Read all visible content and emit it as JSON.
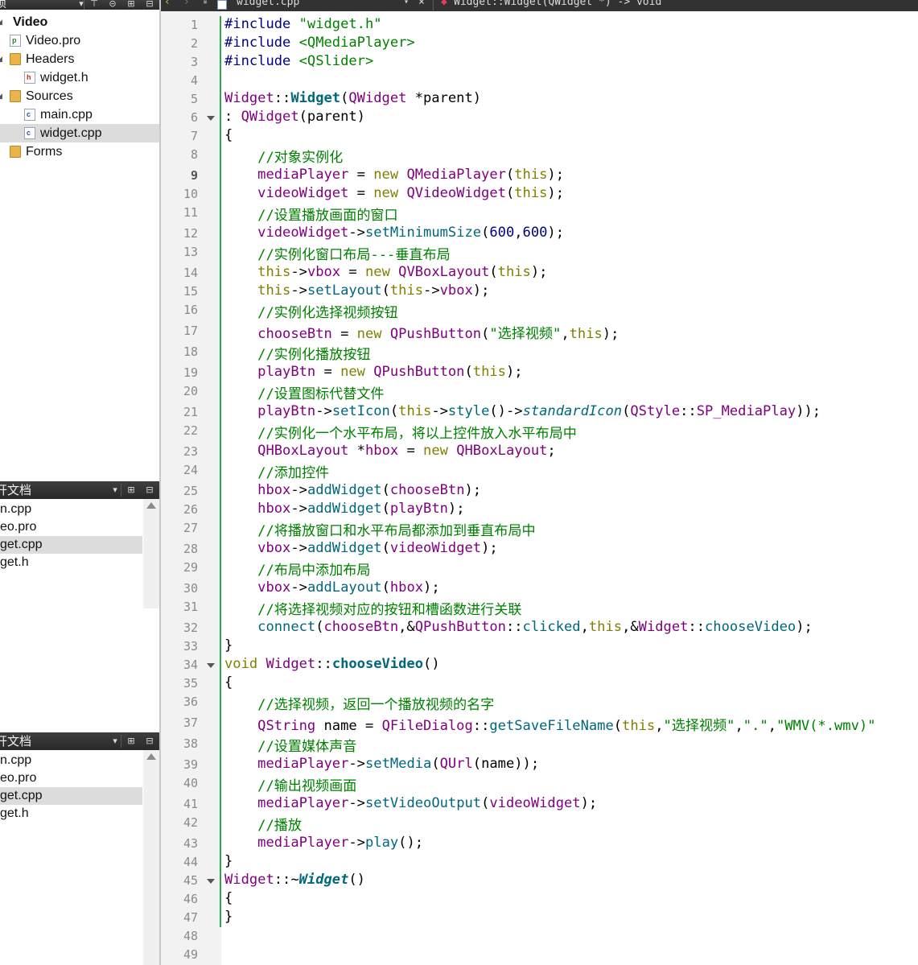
{
  "project_pane": {
    "toolbar_title": "项",
    "tree": [
      {
        "label": "Video",
        "kind": "project",
        "bold": true
      },
      {
        "label": "Video.pro",
        "kind": "pro-file"
      },
      {
        "label": "Headers",
        "kind": "folder"
      },
      {
        "label": "widget.h",
        "kind": "header-file"
      },
      {
        "label": "Sources",
        "kind": "folder"
      },
      {
        "label": "main.cpp",
        "kind": "cpp-file"
      },
      {
        "label": "widget.cpp",
        "kind": "cpp-file",
        "selected": true
      },
      {
        "label": "Forms",
        "kind": "folder"
      }
    ]
  },
  "open_docs_1": {
    "title": "开文档",
    "items": [
      {
        "label": "n.cpp"
      },
      {
        "label": "eo.pro"
      },
      {
        "label": "get.cpp",
        "selected": true
      },
      {
        "label": "get.h"
      }
    ]
  },
  "open_docs_2": {
    "title": "开文档",
    "items": [
      {
        "label": "n.cpp"
      },
      {
        "label": "eo.pro"
      },
      {
        "label": "get.cpp",
        "selected": true
      },
      {
        "label": "get.h"
      }
    ]
  },
  "editor_toolbar": {
    "file_name": "widget.cpp",
    "symbol": "Widget::Widget(QWidget *) -> void"
  },
  "editor": {
    "current_line": 9,
    "fold_lines": [
      6,
      34,
      45
    ],
    "lines": [
      [
        [
          "pre",
          "#include "
        ],
        [
          "str",
          "\"widget.h\""
        ]
      ],
      [
        [
          "pre",
          "#include "
        ],
        [
          "str",
          "<QMediaPlayer>"
        ]
      ],
      [
        [
          "pre",
          "#include "
        ],
        [
          "str",
          "<QSlider>"
        ]
      ],
      [],
      [
        [
          "type",
          "Widget"
        ],
        [
          "plain",
          "::"
        ],
        [
          "def",
          "Widget"
        ],
        [
          "plain",
          "("
        ],
        [
          "type",
          "QWidget"
        ],
        [
          "plain",
          " *parent)"
        ]
      ],
      [
        [
          "plain",
          ": "
        ],
        [
          "type",
          "QWidget"
        ],
        [
          "plain",
          "(parent)"
        ]
      ],
      [
        [
          "plain",
          "{"
        ]
      ],
      [
        [
          "plain",
          "    "
        ],
        [
          "cm",
          "//对象实例化"
        ]
      ],
      [
        [
          "plain",
          "    "
        ],
        [
          "type",
          "mediaPlayer"
        ],
        [
          "plain",
          " = "
        ],
        [
          "kw",
          "new"
        ],
        [
          "plain",
          " "
        ],
        [
          "type",
          "QMediaPlayer"
        ],
        [
          "plain",
          "("
        ],
        [
          "kw",
          "this"
        ],
        [
          "plain",
          ");"
        ]
      ],
      [
        [
          "plain",
          "    "
        ],
        [
          "type",
          "videoWidget"
        ],
        [
          "plain",
          " = "
        ],
        [
          "kw",
          "new"
        ],
        [
          "plain",
          " "
        ],
        [
          "type",
          "QVideoWidget"
        ],
        [
          "plain",
          "("
        ],
        [
          "kw",
          "this"
        ],
        [
          "plain",
          ");"
        ]
      ],
      [
        [
          "plain",
          "    "
        ],
        [
          "cm",
          "//设置播放画面的窗口"
        ]
      ],
      [
        [
          "plain",
          "    "
        ],
        [
          "type",
          "videoWidget"
        ],
        [
          "plain",
          "->"
        ],
        [
          "fn",
          "setMinimumSize"
        ],
        [
          "plain",
          "("
        ],
        [
          "num",
          "600"
        ],
        [
          "plain",
          ","
        ],
        [
          "num",
          "600"
        ],
        [
          "plain",
          ");"
        ]
      ],
      [
        [
          "plain",
          "    "
        ],
        [
          "cm",
          "//实例化窗口布局---垂直布局"
        ]
      ],
      [
        [
          "plain",
          "    "
        ],
        [
          "kw",
          "this"
        ],
        [
          "plain",
          "->"
        ],
        [
          "type",
          "vbox"
        ],
        [
          "plain",
          " = "
        ],
        [
          "kw",
          "new"
        ],
        [
          "plain",
          " "
        ],
        [
          "type",
          "QVBoxLayout"
        ],
        [
          "plain",
          "("
        ],
        [
          "kw",
          "this"
        ],
        [
          "plain",
          ");"
        ]
      ],
      [
        [
          "plain",
          "    "
        ],
        [
          "kw",
          "this"
        ],
        [
          "plain",
          "->"
        ],
        [
          "fn",
          "setLayout"
        ],
        [
          "plain",
          "("
        ],
        [
          "kw",
          "this"
        ],
        [
          "plain",
          "->"
        ],
        [
          "type",
          "vbox"
        ],
        [
          "plain",
          ");"
        ]
      ],
      [
        [
          "plain",
          "    "
        ],
        [
          "cm",
          "//实例化选择视频按钮"
        ]
      ],
      [
        [
          "plain",
          "    "
        ],
        [
          "type",
          "chooseBtn"
        ],
        [
          "plain",
          " = "
        ],
        [
          "kw",
          "new"
        ],
        [
          "plain",
          " "
        ],
        [
          "type",
          "QPushButton"
        ],
        [
          "plain",
          "("
        ],
        [
          "str",
          "\"选择视频\""
        ],
        [
          "plain",
          ","
        ],
        [
          "kw",
          "this"
        ],
        [
          "plain",
          ");"
        ]
      ],
      [
        [
          "plain",
          "    "
        ],
        [
          "cm",
          "//实例化播放按钮"
        ]
      ],
      [
        [
          "plain",
          "    "
        ],
        [
          "type",
          "playBtn"
        ],
        [
          "plain",
          " = "
        ],
        [
          "kw",
          "new"
        ],
        [
          "plain",
          " "
        ],
        [
          "type",
          "QPushButton"
        ],
        [
          "plain",
          "("
        ],
        [
          "kw",
          "this"
        ],
        [
          "plain",
          ");"
        ]
      ],
      [
        [
          "plain",
          "    "
        ],
        [
          "cm",
          "//设置图标代替文件"
        ]
      ],
      [
        [
          "plain",
          "    "
        ],
        [
          "type",
          "playBtn"
        ],
        [
          "plain",
          "->"
        ],
        [
          "fn",
          "setIcon"
        ],
        [
          "plain",
          "("
        ],
        [
          "kw",
          "this"
        ],
        [
          "plain",
          "->"
        ],
        [
          "fn",
          "style"
        ],
        [
          "plain",
          "()->"
        ],
        [
          "ital",
          "standardIcon"
        ],
        [
          "plain",
          "("
        ],
        [
          "type",
          "QStyle"
        ],
        [
          "plain",
          "::"
        ],
        [
          "type",
          "SP_MediaPlay"
        ],
        [
          "plain",
          "));"
        ]
      ],
      [
        [
          "plain",
          "    "
        ],
        [
          "cm",
          "//实例化一个水平布局，将以上控件放入水平布局中"
        ]
      ],
      [
        [
          "plain",
          "    "
        ],
        [
          "type",
          "QHBoxLayout"
        ],
        [
          "plain",
          " *"
        ],
        [
          "type",
          "hbox"
        ],
        [
          "plain",
          " = "
        ],
        [
          "kw",
          "new"
        ],
        [
          "plain",
          " "
        ],
        [
          "type",
          "QHBoxLayout"
        ],
        [
          "plain",
          ";"
        ]
      ],
      [
        [
          "plain",
          "    "
        ],
        [
          "cm",
          "//添加控件"
        ]
      ],
      [
        [
          "plain",
          "    "
        ],
        [
          "type",
          "hbox"
        ],
        [
          "plain",
          "->"
        ],
        [
          "fn",
          "addWidget"
        ],
        [
          "plain",
          "("
        ],
        [
          "type",
          "chooseBtn"
        ],
        [
          "plain",
          ");"
        ]
      ],
      [
        [
          "plain",
          "    "
        ],
        [
          "type",
          "hbox"
        ],
        [
          "plain",
          "->"
        ],
        [
          "fn",
          "addWidget"
        ],
        [
          "plain",
          "("
        ],
        [
          "type",
          "playBtn"
        ],
        [
          "plain",
          ");"
        ]
      ],
      [
        [
          "plain",
          "    "
        ],
        [
          "cm",
          "//将播放窗口和水平布局都添加到垂直布局中"
        ]
      ],
      [
        [
          "plain",
          "    "
        ],
        [
          "type",
          "vbox"
        ],
        [
          "plain",
          "->"
        ],
        [
          "fn",
          "addWidget"
        ],
        [
          "plain",
          "("
        ],
        [
          "type",
          "videoWidget"
        ],
        [
          "plain",
          ");"
        ]
      ],
      [
        [
          "plain",
          "    "
        ],
        [
          "cm",
          "//布局中添加布局"
        ]
      ],
      [
        [
          "plain",
          "    "
        ],
        [
          "type",
          "vbox"
        ],
        [
          "plain",
          "->"
        ],
        [
          "fn",
          "addLayout"
        ],
        [
          "plain",
          "("
        ],
        [
          "type",
          "hbox"
        ],
        [
          "plain",
          ");"
        ]
      ],
      [
        [
          "plain",
          "    "
        ],
        [
          "cm",
          "//将选择视频对应的按钮和槽函数进行关联"
        ]
      ],
      [
        [
          "plain",
          "    "
        ],
        [
          "fn",
          "connect"
        ],
        [
          "plain",
          "("
        ],
        [
          "type",
          "chooseBtn"
        ],
        [
          "plain",
          ",&"
        ],
        [
          "type",
          "QPushButton"
        ],
        [
          "plain",
          "::"
        ],
        [
          "fn",
          "clicked"
        ],
        [
          "plain",
          ","
        ],
        [
          "kw",
          "this"
        ],
        [
          "plain",
          ",&"
        ],
        [
          "type",
          "Widget"
        ],
        [
          "plain",
          "::"
        ],
        [
          "fn",
          "chooseVideo"
        ],
        [
          "plain",
          ");"
        ]
      ],
      [
        [
          "plain",
          "}"
        ]
      ],
      [
        [
          "kw",
          "void"
        ],
        [
          "plain",
          " "
        ],
        [
          "type",
          "Widget"
        ],
        [
          "plain",
          "::"
        ],
        [
          "def",
          "chooseVideo"
        ],
        [
          "plain",
          "()"
        ]
      ],
      [
        [
          "plain",
          "{"
        ]
      ],
      [
        [
          "plain",
          "    "
        ],
        [
          "cm",
          "//选择视频，返回一个播放视频的名字"
        ]
      ],
      [
        [
          "plain",
          "    "
        ],
        [
          "type",
          "QString"
        ],
        [
          "plain",
          " name = "
        ],
        [
          "type",
          "QFileDialog"
        ],
        [
          "plain",
          "::"
        ],
        [
          "fn",
          "getSaveFileName"
        ],
        [
          "plain",
          "("
        ],
        [
          "kw",
          "this"
        ],
        [
          "plain",
          ","
        ],
        [
          "str",
          "\"选择视频\""
        ],
        [
          "plain",
          ","
        ],
        [
          "str",
          "\".\""
        ],
        [
          "plain",
          ","
        ],
        [
          "str",
          "\"WMV(*.wmv)\""
        ]
      ],
      [
        [
          "plain",
          "    "
        ],
        [
          "cm",
          "//设置媒体声音"
        ]
      ],
      [
        [
          "plain",
          "    "
        ],
        [
          "type",
          "mediaPlayer"
        ],
        [
          "plain",
          "->"
        ],
        [
          "fn",
          "setMedia"
        ],
        [
          "plain",
          "("
        ],
        [
          "type",
          "QUrl"
        ],
        [
          "plain",
          "(name));"
        ]
      ],
      [
        [
          "plain",
          "    "
        ],
        [
          "cm",
          "//输出视频画面"
        ]
      ],
      [
        [
          "plain",
          "    "
        ],
        [
          "type",
          "mediaPlayer"
        ],
        [
          "plain",
          "->"
        ],
        [
          "fn",
          "setVideoOutput"
        ],
        [
          "plain",
          "("
        ],
        [
          "type",
          "videoWidget"
        ],
        [
          "plain",
          ");"
        ]
      ],
      [
        [
          "plain",
          "    "
        ],
        [
          "cm",
          "//播放"
        ]
      ],
      [
        [
          "plain",
          "    "
        ],
        [
          "type",
          "mediaPlayer"
        ],
        [
          "plain",
          "->"
        ],
        [
          "fn",
          "play"
        ],
        [
          "plain",
          "();"
        ]
      ],
      [
        [
          "plain",
          "}"
        ]
      ],
      [
        [
          "type",
          "Widget"
        ],
        [
          "plain",
          "::~"
        ],
        [
          "defi",
          "Widget"
        ],
        [
          "plain",
          "()"
        ]
      ],
      [
        [
          "plain",
          "{"
        ]
      ],
      [
        [
          "plain",
          "}"
        ]
      ],
      [],
      []
    ]
  }
}
